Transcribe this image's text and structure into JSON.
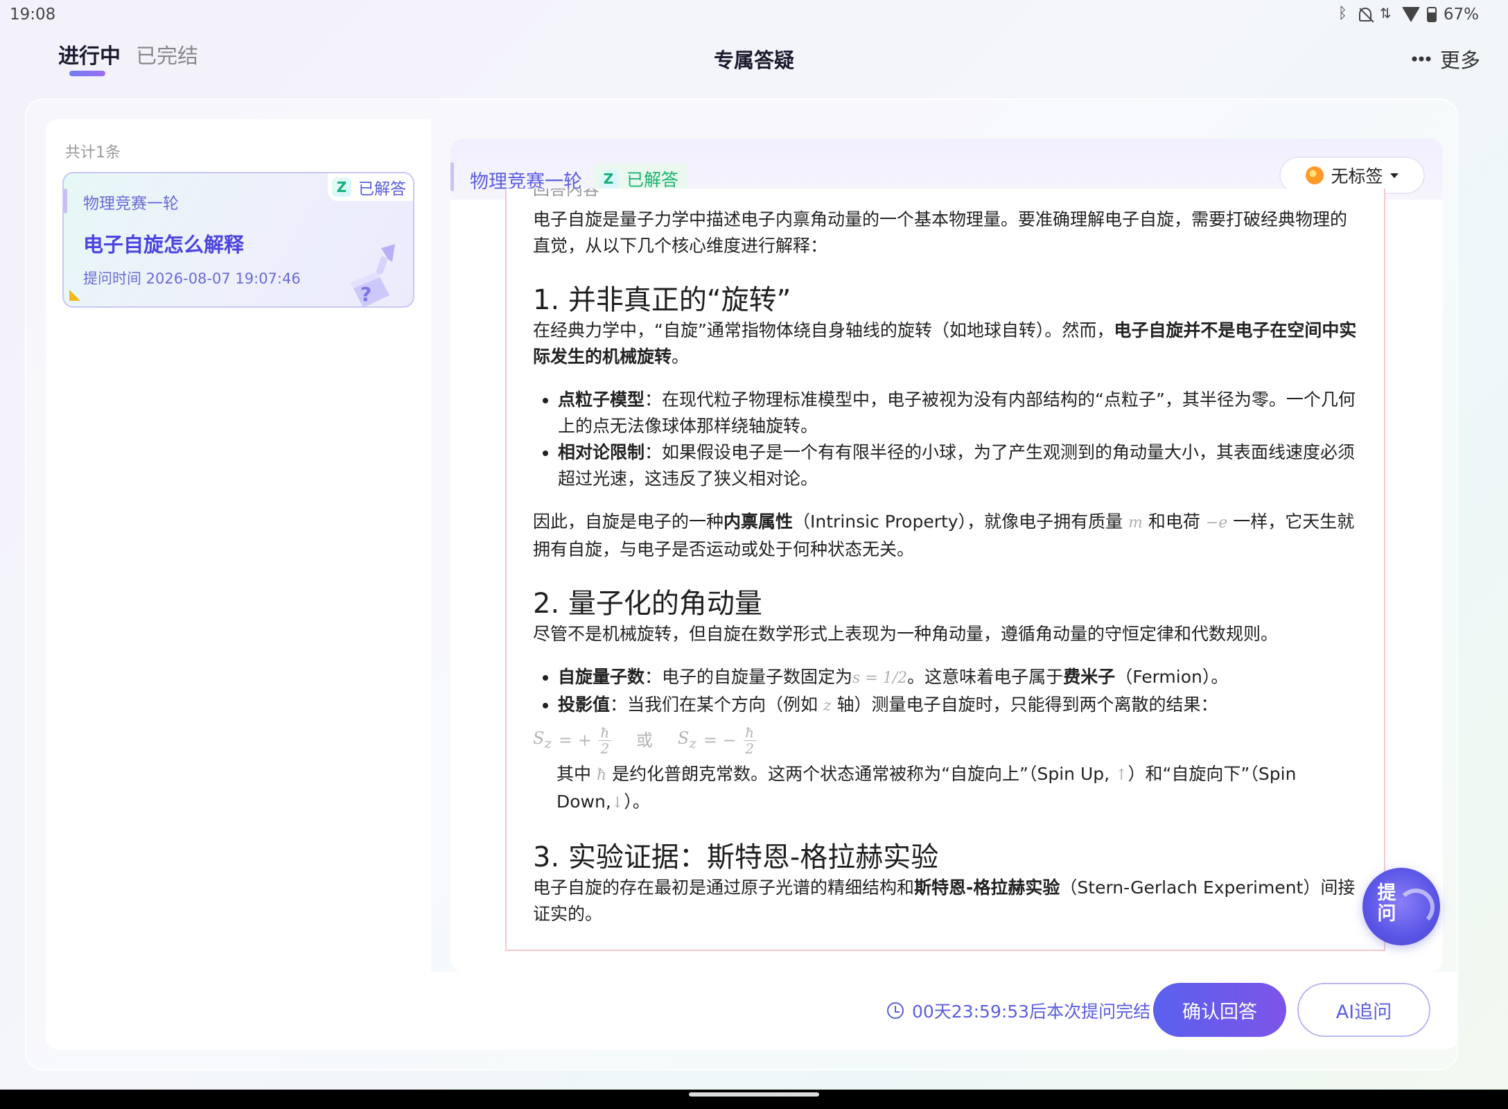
{
  "status_bar": {
    "time": "19:08",
    "battery": "67%",
    "icons": [
      "bluetooth-icon",
      "bell-off-icon",
      "data-icon",
      "wifi-icon",
      "battery-icon"
    ]
  },
  "nav": {
    "tabs": [
      {
        "label": "进行中",
        "active": true
      },
      {
        "label": "已完结",
        "active": false
      }
    ],
    "title": "专属答疑",
    "more_label": "更多"
  },
  "list": {
    "count_label": "共计1条",
    "items": [
      {
        "category": "物理竞赛一轮",
        "status": "已解答",
        "title": "电子自旋怎么解释",
        "time": "提问时间 2026-08-07 19:07:46"
      }
    ]
  },
  "detail": {
    "category": "物理竞赛一轮",
    "status": "已解答",
    "tag_label": "无标签",
    "section_label": "回答内容",
    "intro": "电子自旋是量子力学中描述电子内禀角动量的一个基本物理量。要准确理解电子自旋，需要打破经典物理的直觉，从以下几个核心维度进行解释：",
    "s1": {
      "heading": "1. 并非真正的“旋转”",
      "p1a": "在经典力学中，“自旋”通常指物体绕自身轴线的旋转（如地球自转）。然而，",
      "p1b": "电子自旋并不是电子在空间中实际发生的机械旋转",
      "p1c": "。",
      "b1_label": "点粒子模型",
      "b1_text": "：在现代粒子物理标准模型中，电子被视为没有内部结构的“点粒子”，其半径为零。一个几何上的点无法像球体那样绕轴旋转。",
      "b2_label": "相对论限制",
      "b2_text": "：如果假设电子是一个有有限半径的小球，为了产生观测到的角动量大小，其表面线速度必须超过光速，这违反了狭义相对论。",
      "p2a": "因此，自旋是电子的一种",
      "p2b": "内禀属性",
      "p2c": "（Intrinsic Property），就像电子拥有质量",
      "p2_m": "m",
      "p2d": "和电荷",
      "p2_e": "−e",
      "p2e": "一样，它天生就拥有自旋，与电子是否运动或处于何种状态无关。"
    },
    "s2": {
      "heading": "2. 量子化的角动量",
      "p1": "尽管不是机械旋转，但自旋在数学形式上表现为一种角动量，遵循角动量的守恒定律和代数规则。",
      "b1_label": "自旋量子数",
      "b1_a": "：电子的自旋量子数固定为",
      "b1_math": "s = 1/2",
      "b1_b": "。这意味着电子属于",
      "b1_bold": "费米子",
      "b1_c": "（Fermion）。",
      "b2_label": "投影值",
      "b2_a": "：当我们在某个方向（例如",
      "b2_math": "z",
      "b2_b": "轴）测量电子自旋时，只能得到两个离散的结果：",
      "formula_left": "S",
      "formula_sub": "z",
      "formula_plus": "= +",
      "formula_minus": "= −",
      "formula_num": "ħ",
      "formula_den": "2",
      "formula_or": "或",
      "note_a": "其中",
      "note_hbar": "ħ",
      "note_b": "是约化普朗克常数。这两个状态通常被称为“自旋向上”（Spin  Up,",
      "note_up": "↑",
      "note_c": "）和“自旋向下”（Spin Down,",
      "note_down": "↓",
      "note_d": "）。"
    },
    "s3": {
      "heading": "3. 实验证据：斯特恩-格拉赫实验",
      "p1a": "电子自旋的存在最初是通过原子光谱的精细结构和",
      "p1b": "斯特恩-格拉赫实验",
      "p1c": "（Stern-Gerlach  Experiment）间接证实的。"
    }
  },
  "footer": {
    "countdown": "00天23:59:53后本次提问完结",
    "confirm_label": "确认回答",
    "ai_label": "AI追问"
  },
  "fab": {
    "label": "提问"
  },
  "colors": {
    "accent": "#5b5de0",
    "success": "#1bb46f",
    "tag_orange": "#ff9a2a"
  }
}
